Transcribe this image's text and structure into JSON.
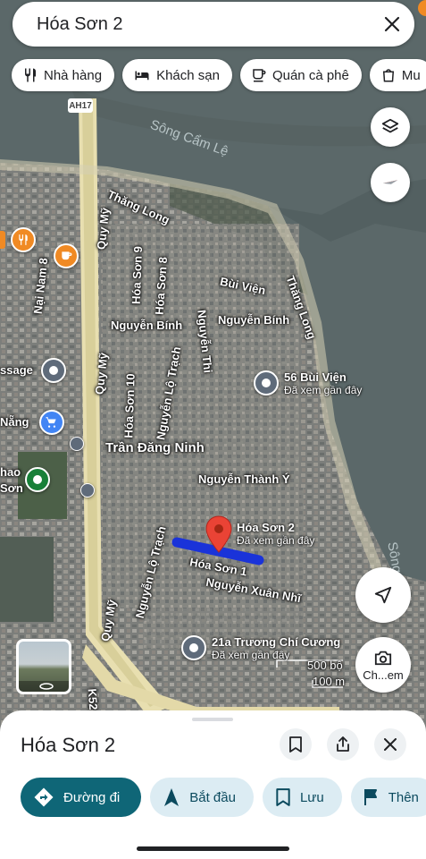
{
  "search": {
    "query": "Hóa Sơn 2"
  },
  "chips": [
    {
      "label": "Nhà hàng",
      "icon": "fork-knife-icon"
    },
    {
      "label": "Khách sạn",
      "icon": "bed-icon"
    },
    {
      "label": "Quán cà phê",
      "icon": "coffee-icon"
    },
    {
      "label": "Mu",
      "icon": "shopping-bag-icon"
    }
  ],
  "map": {
    "highway_shield": "AH17",
    "water": {
      "river": "Sông Cẩm Lệ",
      "river_right": "Sông C"
    },
    "streets": {
      "thang_long_1": "Thăng Long",
      "thang_long_2": "Thăng Long",
      "quy_my_1": "Quy Mỹ",
      "quy_my_2": "Quy Mỹ",
      "quy_my_3": "Quy Mỹ",
      "hoa_son_9": "Hóa Sơn 9",
      "hoa_son_8": "Hóa Sơn 8",
      "hoa_son_10": "Hóa Sơn 10",
      "bui_vien": "Bùi Viện",
      "nguyen_binh_1": "Nguyễn Bính",
      "nguyen_binh_2": "Nguyễn Bính",
      "nguyen_thi": "Nguyễn Thi",
      "nguyen_lo_trach_1": "Nguyễn Lộ Trạch",
      "nguyen_lo_trach_2": "Nguyễn Lộ Trạch",
      "tran_dang_ninh": "Trần Đăng Ninh",
      "nguyen_thanh_y": "Nguyễn Thành Ý",
      "hoa_son_1": "Hóa Sơn 1",
      "nguyen_xuan_nhi": "Nguyễn Xuân Nhĩ",
      "nai_nam_8": "Nại Nam 8",
      "k52": "K52",
      "ssage": "ssage",
      "nang": "Nẵng",
      "hao": "hao",
      "son": "Sơn"
    },
    "pins": {
      "bui_vien_56": {
        "title": "56 Bùi Viện",
        "sub": "Đã xem gần đây"
      },
      "selected": {
        "title": "Hóa Sơn 2",
        "sub": "Đã xem gần đây"
      },
      "truong_chi_cuong": {
        "title": "21a Trương Chí Cương",
        "sub": "Đã xem gần đây"
      }
    },
    "scale": {
      "top": "500 bộ",
      "bottom": "100 m"
    },
    "colors": {
      "route": "#1a33d9",
      "selected_pin": "#ea4335"
    }
  },
  "fabs": {
    "layers": "layers-icon",
    "compass": "compass-icon",
    "location": "my-location-icon",
    "lens_label": "Ch...em"
  },
  "sheet": {
    "title": "Hóa Sơn 2",
    "actions": [
      {
        "label": "Đường đi",
        "icon": "directions-icon"
      },
      {
        "label": "Bắt đầu",
        "icon": "navigation-icon"
      },
      {
        "label": "Lưu",
        "icon": "bookmark-icon"
      },
      {
        "label": "Thên",
        "icon": "flag-icon"
      }
    ]
  }
}
